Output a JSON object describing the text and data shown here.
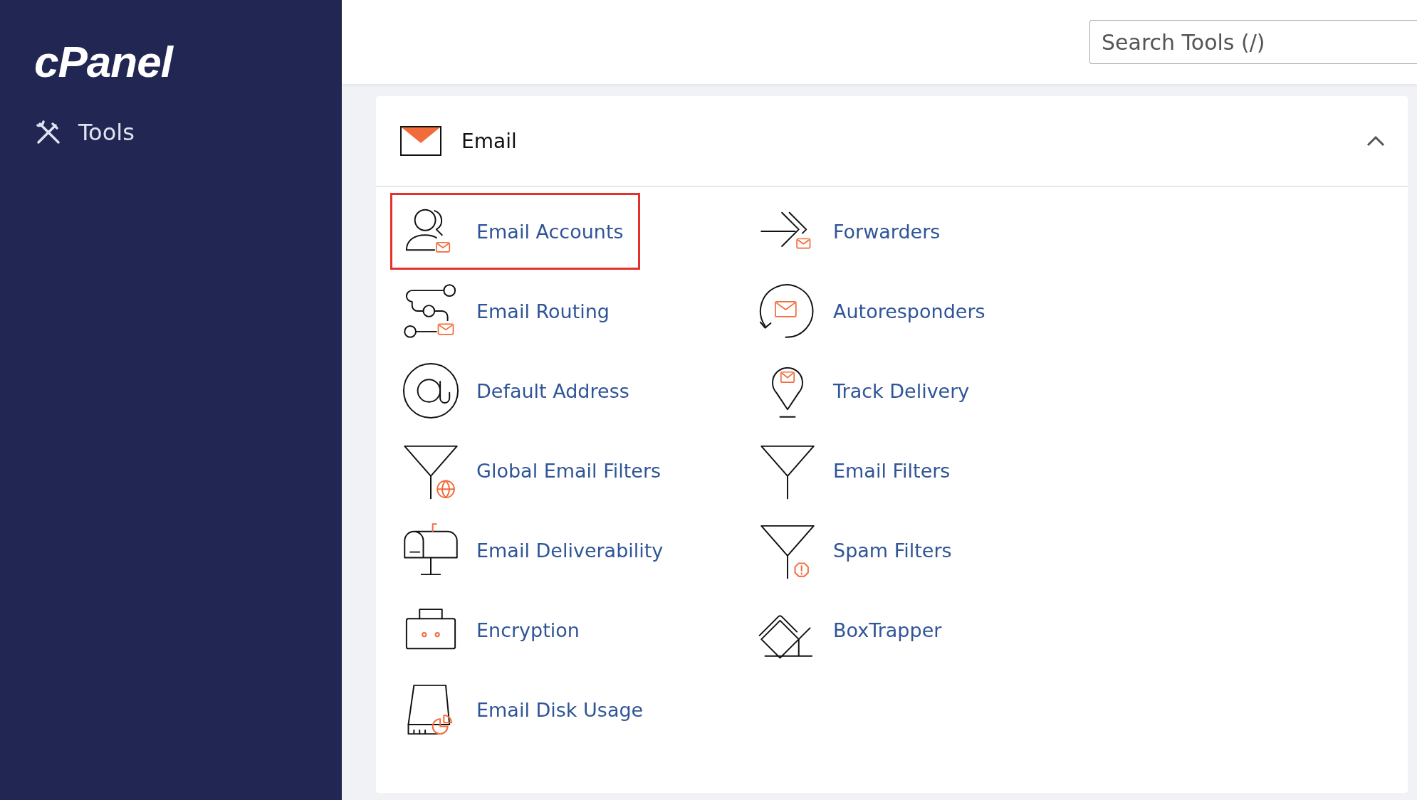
{
  "sidebar": {
    "logo": "cPanel",
    "items": [
      {
        "label": "Tools",
        "selected": false
      }
    ]
  },
  "search": {
    "placeholder": "Search Tools (/)"
  },
  "section": {
    "title": "Email",
    "expanded": true,
    "items": [
      {
        "label": "Email Accounts",
        "highlighted": true
      },
      {
        "label": "Forwarders",
        "highlighted": false
      },
      {
        "label": "Email Routing",
        "highlighted": false
      },
      {
        "label": "Autoresponders",
        "highlighted": false
      },
      {
        "label": "Default Address",
        "highlighted": false
      },
      {
        "label": "Track Delivery",
        "highlighted": false
      },
      {
        "label": "Global Email Filters",
        "highlighted": false
      },
      {
        "label": "Email Filters",
        "highlighted": false
      },
      {
        "label": "Email Deliverability",
        "highlighted": false
      },
      {
        "label": "Spam Filters",
        "highlighted": false
      },
      {
        "label": "Encryption",
        "highlighted": false
      },
      {
        "label": "BoxTrapper",
        "highlighted": false
      },
      {
        "label": "Email Disk Usage",
        "highlighted": false
      }
    ]
  }
}
